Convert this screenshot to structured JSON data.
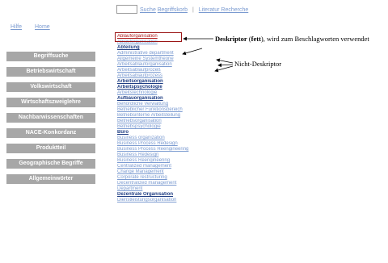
{
  "top_nav": {
    "hilfe": "Hilfe",
    "home": "Home"
  },
  "search": {
    "input_value": "",
    "suche": "Suche",
    "begriffskorb": "Begriffskorb",
    "separator": "|",
    "literatur": "Literatur Recherche"
  },
  "sidebar": {
    "items": [
      {
        "label": "Begriffsuche"
      },
      {
        "label": "Betriebswirtschaft"
      },
      {
        "label": "Volkswirtschaft"
      },
      {
        "label": "Wirtschaftszweiglehre"
      },
      {
        "label": "Nachbarwissenschaften"
      },
      {
        "label": "NACE-Konkordanz"
      },
      {
        "label": "Produktteil"
      },
      {
        "label": "Geographische Begriffe"
      },
      {
        "label": "Allgemeinwörter"
      }
    ]
  },
  "terms": [
    {
      "label": "Ablauforganisation",
      "kind": "red"
    },
    {
      "label": "Ablauforganisation",
      "kind": "plain"
    },
    {
      "label": "Abteilung",
      "kind": "descriptor"
    },
    {
      "label": "Administrative department",
      "kind": "plain"
    },
    {
      "label": "Allgemeine Systemtheorie",
      "kind": "plain"
    },
    {
      "label": "Arbeitsablauforganisation",
      "kind": "plain"
    },
    {
      "label": "Arbeitsablaufprozeß",
      "kind": "plain"
    },
    {
      "label": "Arbeitsablaufprozess",
      "kind": "plain"
    },
    {
      "label": "Arbeitsorganisation",
      "kind": "descriptor"
    },
    {
      "label": "Arbeitspsychologie",
      "kind": "descriptor"
    },
    {
      "label": "Arbeitstechnologie",
      "kind": "plain"
    },
    {
      "label": "Aufbauorganisation",
      "kind": "descriptor"
    },
    {
      "label": "Behördliche Verwaltung",
      "kind": "plain"
    },
    {
      "label": "Betrieblicher Funktionsbereich",
      "kind": "plain"
    },
    {
      "label": "Betriebsinterne Arbeitsteilung",
      "kind": "plain"
    },
    {
      "label": "Betriebsorganisation",
      "kind": "plain"
    },
    {
      "label": "Betriebspsychologie",
      "kind": "plain"
    },
    {
      "label": "Büro",
      "kind": "descriptor"
    },
    {
      "label": "Business organization",
      "kind": "plain"
    },
    {
      "label": "Business Process Redesign",
      "kind": "plain"
    },
    {
      "label": "Business Process Reengineering",
      "kind": "plain"
    },
    {
      "label": "Business Redesign",
      "kind": "plain"
    },
    {
      "label": "Business Reengineering",
      "kind": "plain"
    },
    {
      "label": "Centralized management",
      "kind": "plain"
    },
    {
      "label": "Change Management",
      "kind": "plain"
    },
    {
      "label": "Corporate restructuring",
      "kind": "plain"
    },
    {
      "label": "Decentralized management",
      "kind": "plain"
    },
    {
      "label": "Department",
      "kind": "plain"
    },
    {
      "label": "Dezentrale Organisation",
      "kind": "descriptor"
    },
    {
      "label": "Dienstleistungsorganisation",
      "kind": "plain"
    }
  ],
  "annotations": {
    "descriptor_bold": "Deskriptor",
    "descriptor_open": " (",
    "descriptor_fett": "fett",
    "descriptor_rest": "), wird zum Beschlagworten verwendet",
    "nicht_deskriptor": "Nicht-Deskriptor"
  },
  "colors": {
    "link": "#7a9ad0",
    "descriptor": "#1f3e84",
    "highlight_border": "#9a1414",
    "sidebar_button": "#a7a7a7"
  }
}
